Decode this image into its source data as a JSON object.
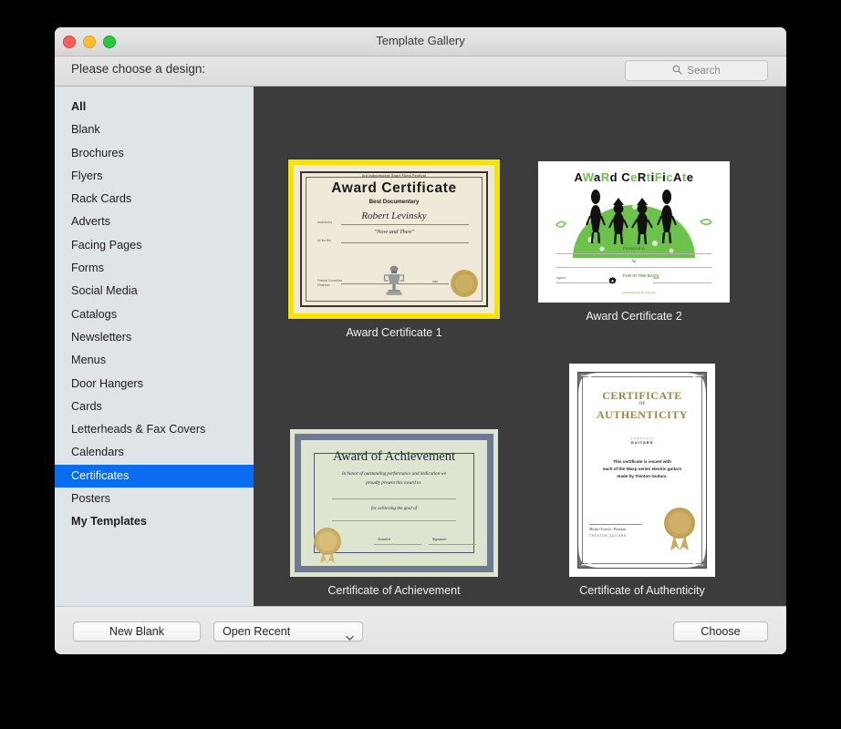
{
  "window": {
    "title": "Template Gallery",
    "traffic_lights": [
      "close-red",
      "minimize-yellow",
      "zoom-green"
    ]
  },
  "subheader": {
    "prompt": "Please choose a design:",
    "search_placeholder": "Search",
    "search_value": ""
  },
  "sidebar": {
    "items": [
      {
        "label": "All",
        "bold": true,
        "selected": false
      },
      {
        "label": "Blank",
        "bold": false,
        "selected": false
      },
      {
        "label": "Brochures",
        "bold": false,
        "selected": false
      },
      {
        "label": "Flyers",
        "bold": false,
        "selected": false
      },
      {
        "label": "Rack Cards",
        "bold": false,
        "selected": false
      },
      {
        "label": "Adverts",
        "bold": false,
        "selected": false
      },
      {
        "label": "Facing Pages",
        "bold": false,
        "selected": false
      },
      {
        "label": "Forms",
        "bold": false,
        "selected": false
      },
      {
        "label": "Social Media",
        "bold": false,
        "selected": false
      },
      {
        "label": "Catalogs",
        "bold": false,
        "selected": false
      },
      {
        "label": "Newsletters",
        "bold": false,
        "selected": false
      },
      {
        "label": "Menus",
        "bold": false,
        "selected": false
      },
      {
        "label": "Door Hangers",
        "bold": false,
        "selected": false
      },
      {
        "label": "Cards",
        "bold": false,
        "selected": false
      },
      {
        "label": "Letterheads & Fax Covers",
        "bold": false,
        "selected": false
      },
      {
        "label": "Calendars",
        "bold": false,
        "selected": false
      },
      {
        "label": "Certificates",
        "bold": false,
        "selected": true
      },
      {
        "label": "Posters",
        "bold": false,
        "selected": false
      },
      {
        "label": "My Templates",
        "bold": true,
        "selected": false
      }
    ],
    "selected_label": "Certificates"
  },
  "gallery": {
    "templates": [
      {
        "caption": "Award Certificate 1",
        "selected": true
      },
      {
        "caption": "Award Certificate 2",
        "selected": false
      },
      {
        "caption": "Certificate of Achievement",
        "selected": false
      },
      {
        "caption": "Certificate of Authenticity",
        "selected": false
      }
    ]
  },
  "cert1": {
    "festival": "3rd Independent Short Films Festival",
    "title": "Award  Certificate",
    "subtitle": "Best Documentary",
    "name": "Robert Levinsky",
    "film": "\"Now and Then\"",
    "label_awarded_to": "Awarded to",
    "label_for_the_film": "for the film",
    "label_festival_committee": "Festival Committee",
    "label_chairman": "Chairman",
    "label_date": "date"
  },
  "cert2": {
    "title_letters": [
      "A",
      "W",
      "a",
      "R",
      "d",
      " ",
      "C",
      "e",
      "R",
      "t",
      "i",
      "F",
      "i",
      "c",
      "A",
      "t",
      "e"
    ],
    "title": "AWaRd CeRtiFicAte",
    "presented_to": "Presented to",
    "for": "for",
    "label_signed": "signed",
    "label_date": "date",
    "logo_name": "FUN IN THE BACK",
    "logo_tagline": "entertaining fun for everyone"
  },
  "cert3": {
    "title": "Award of Achievement",
    "line1": "In honor of outstanding performance and dedication we",
    "line2": "proudly present this award to:",
    "line3": "for achieving the goal of",
    "label_awarded": "Awarded",
    "label_signature": "Signature"
  },
  "cert4": {
    "title_line1": "CERTIFICATE",
    "title_of": "OF",
    "title_line2": "AUTHENTICITY",
    "brand_top": "TRENTON",
    "brand_bottom": "GUITARS",
    "body_line1": "This certificate is issued with",
    "body_line2": "each of the Wasp series electric guitars",
    "body_line3": "made by Trenton Guitars.",
    "signer_name": "Michael Trenton - President",
    "signer_company": "TRENTON  GUITARS"
  },
  "footer": {
    "new_blank_label": "New Blank",
    "open_recent_label": "Open Recent",
    "choose_label": "Choose"
  },
  "colors": {
    "selection_blue": "#0a6cf0",
    "thumbnail_selection_yellow": "#f5e400",
    "sidebar_bg": "#dfe4e9",
    "content_bg": "#3c3c3c"
  }
}
